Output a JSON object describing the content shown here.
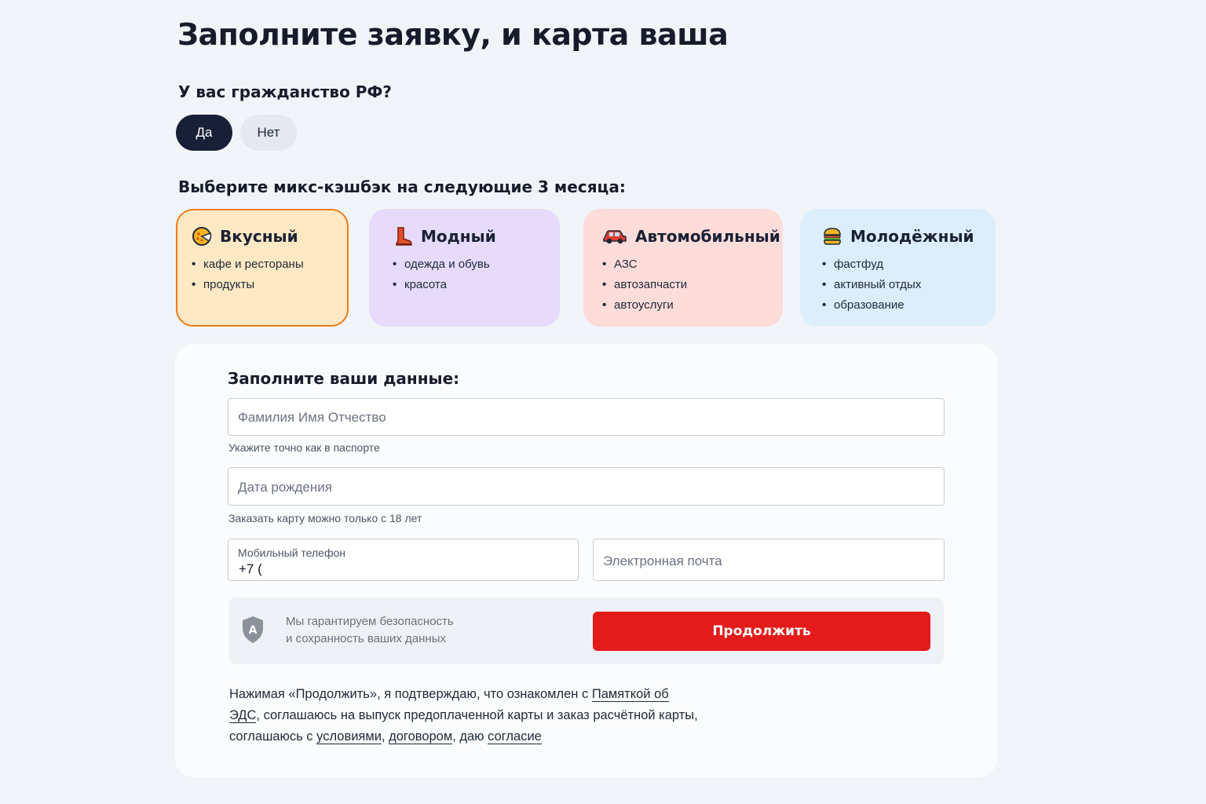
{
  "page": {
    "title": "Заполните заявку, и карта ваша"
  },
  "citizenship": {
    "question": "У вас гражданство РФ?",
    "yes": "Да",
    "no": "Нет",
    "selected": "Да"
  },
  "cashback": {
    "heading": "Выберите микс-кэшбэк на следующие 3 месяца:",
    "selected": "Вкусный",
    "categories": [
      {
        "name": "Вкусный",
        "icon": "food-icon",
        "items": [
          "кафе и рестораны",
          "продукты"
        ]
      },
      {
        "name": "Модный",
        "icon": "boot-icon",
        "items": [
          "одежда и обувь",
          "красота"
        ]
      },
      {
        "name": "Автомобильный",
        "icon": "car-icon",
        "items": [
          "АЗС",
          "автозапчасти",
          "автоуслуги"
        ]
      },
      {
        "name": "Молодёжный",
        "icon": "burger-icon",
        "items": [
          "фастфуд",
          "активный отдых",
          "образование"
        ]
      }
    ]
  },
  "form": {
    "title": "Заполните ваши данные:",
    "name_placeholder": "Фамилия Имя Отчество",
    "name_hint": "Укажите точно как в паспорте",
    "dob_placeholder": "Дата рождения",
    "dob_hint": "Заказать карту можно только с 18 лет",
    "phone_label": "Мобильный телефон",
    "phone_value": "+7 (",
    "email_placeholder": "Электронная почта"
  },
  "security": {
    "line1": "Мы гарантируем безопасность",
    "line2": "и сохранность ваших данных",
    "shield_letter": "A"
  },
  "continue_label": "Продолжить",
  "consent": {
    "part1": "Нажимая «Продолжить», я подтверждаю, что ознакомлен с ",
    "link1": "Памяткой об ЭДС",
    "part2": ", соглашаюсь на выпуск предоплаченной карты  и заказ расчётной карты, соглашаюсь с ",
    "link2": "условиями",
    "sep1": ", ",
    "link3": "договором",
    "part3": ", даю ",
    "link4": "согласие"
  },
  "colors": {
    "accent_red": "#e31b1b",
    "dark_navy": "#172036",
    "selected_border": "#ef7d1a"
  }
}
